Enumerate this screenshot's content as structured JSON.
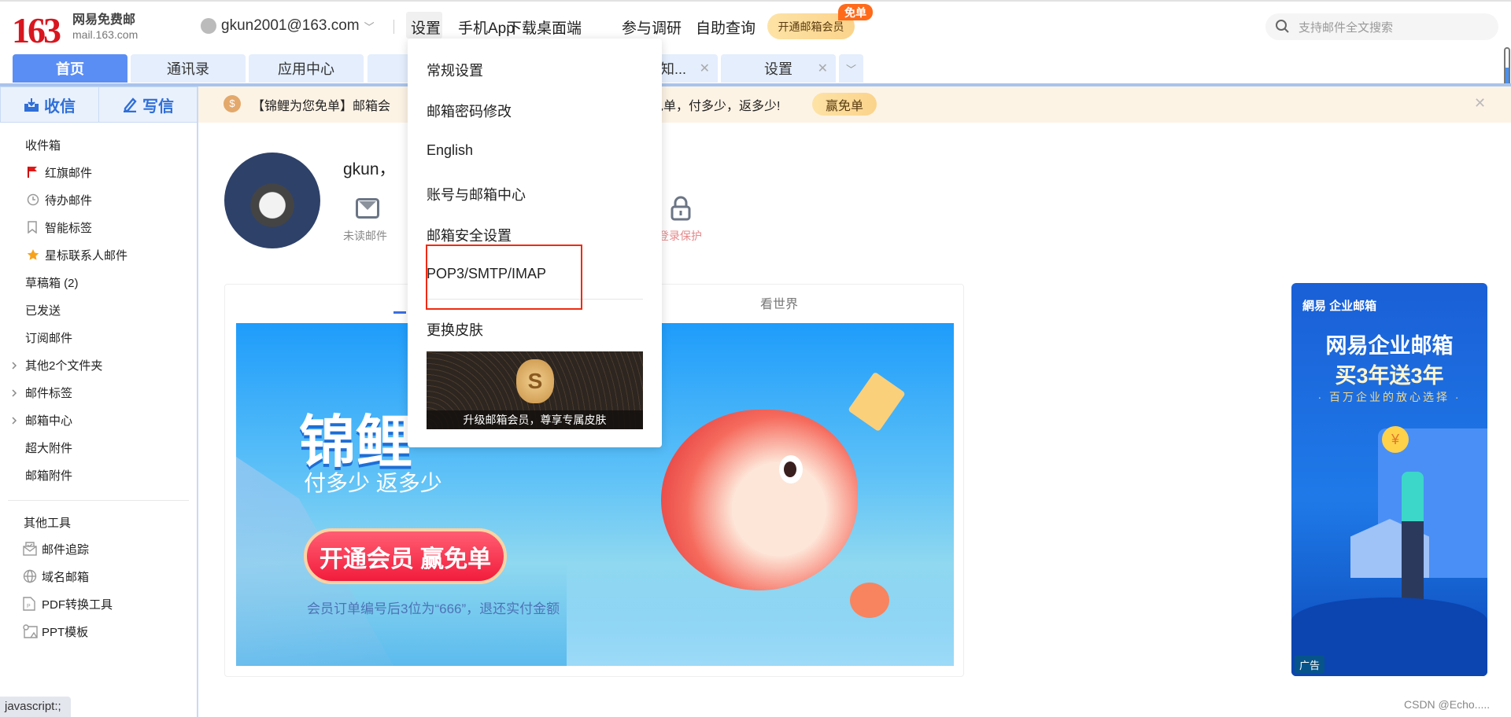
{
  "header": {
    "logo_number": "163",
    "logo_name": "网易免费邮",
    "logo_domain": "mail.163.com",
    "account": "gkun2001@163.com",
    "nav": [
      "设置",
      "手机App",
      "下载桌面端",
      "参与调研",
      "自助查询"
    ],
    "vip_button": "开通邮箱会员",
    "vip_badge": "免单",
    "search_placeholder": "支持邮件全文搜索"
  },
  "tabs": [
    {
      "label": "首页"
    },
    {
      "label": "通讯录"
    },
    {
      "label": "应用中心"
    },
    {
      "label": ""
    },
    {
      "label": ""
    },
    {
      "label": "知..."
    },
    {
      "label": "设置"
    }
  ],
  "sidebar": {
    "receive": "收信",
    "write": "写信",
    "folders": [
      {
        "label": "收件箱",
        "icon": ""
      },
      {
        "label": "红旗邮件",
        "icon": "flag-icon"
      },
      {
        "label": "待办邮件",
        "icon": "clock-icon"
      },
      {
        "label": "智能标签",
        "icon": "bookmark-icon"
      },
      {
        "label": "星标联系人邮件",
        "icon": "star-icon"
      },
      {
        "label": "草稿箱 (2)",
        "icon": ""
      },
      {
        "label": "已发送",
        "icon": ""
      },
      {
        "label": "订阅邮件",
        "icon": ""
      },
      {
        "label": "其他2个文件夹",
        "icon": "chevron-right-icon"
      },
      {
        "label": "邮件标签",
        "icon": "chevron-right-icon"
      },
      {
        "label": "邮箱中心",
        "icon": "chevron-right-icon"
      },
      {
        "label": "超大附件",
        "icon": ""
      },
      {
        "label": "邮箱附件",
        "icon": ""
      }
    ],
    "tools_title": "其他工具",
    "tools": [
      {
        "label": "邮件追踪",
        "icon": "mail-track-icon"
      },
      {
        "label": "域名邮箱",
        "icon": "globe-icon"
      },
      {
        "label": "PDF转换工具",
        "icon": "pdf-icon"
      },
      {
        "label": "PPT模板",
        "icon": "ppt-icon"
      }
    ]
  },
  "notice": {
    "text_left": "【锦鲤为您免单】邮箱会",
    "text_right": "免单，付多少，返多少!",
    "button": "赢免单"
  },
  "profile": {
    "greeting": "gkun，",
    "unread_label": "未读邮件",
    "protect_label": "登录保护"
  },
  "card": {
    "tab_right": "看世界"
  },
  "banner": {
    "title": "锦鲤",
    "subtitle": "付多少 返多少",
    "button": "开通会员 赢免单",
    "fineprint": "会员订单编号后3位为“666”，退还实付金额"
  },
  "menu": {
    "items": [
      "常规设置",
      "邮箱密码修改",
      "English",
      "账号与邮箱中心",
      "邮箱安全设置",
      "POP3/SMTP/IMAP",
      "更换皮肤"
    ],
    "skin_caption": "升级邮箱会员，尊享专属皮肤",
    "highlight_color": "#f02a10"
  },
  "ad": {
    "brand": "網易 企业邮箱",
    "line1": "网易企业邮箱",
    "line2": "买3年送3年",
    "line3": "· 百万企业的放心选择 ·",
    "tag": "广告"
  },
  "status_bar": "javascript:;",
  "watermark": "CSDN @Echo....."
}
